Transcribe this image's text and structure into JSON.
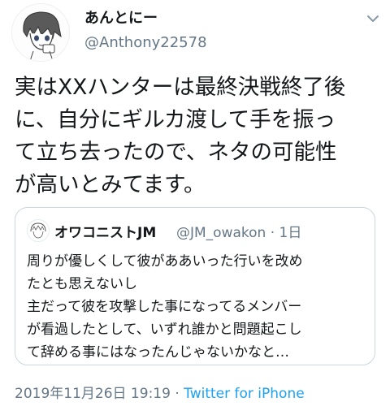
{
  "author": {
    "display_name": "あんとにー",
    "handle": "@Anthony22578",
    "avatar_icon": "anime-avatar-icon"
  },
  "tweet": {
    "text": "実はXXハンターは最終決戦終了後\nに、自分にギルカ渡して手を振っ\nて立ち去ったので、ネタの可能性\nが高いとみてます。"
  },
  "quoted": {
    "name": "オワコニストJM",
    "meta": "@JM_owakon · 1日",
    "text": "周りが優しくして彼がああいった行いを改め\nたとも思えないし\n主だって彼を攻撃した事になってるメンバー\nが看過したとして、いずれ誰かと問題起こし\nて辞める事にはなったんじゃないかなと…"
  },
  "footer": {
    "timestamp": "2019年11月26日 19:19 · ",
    "source": "Twitter for iPhone"
  },
  "colors": {
    "text": "#14171a",
    "secondary": "#657786",
    "link": "#1da1f2",
    "border": "#ccd6dd"
  }
}
